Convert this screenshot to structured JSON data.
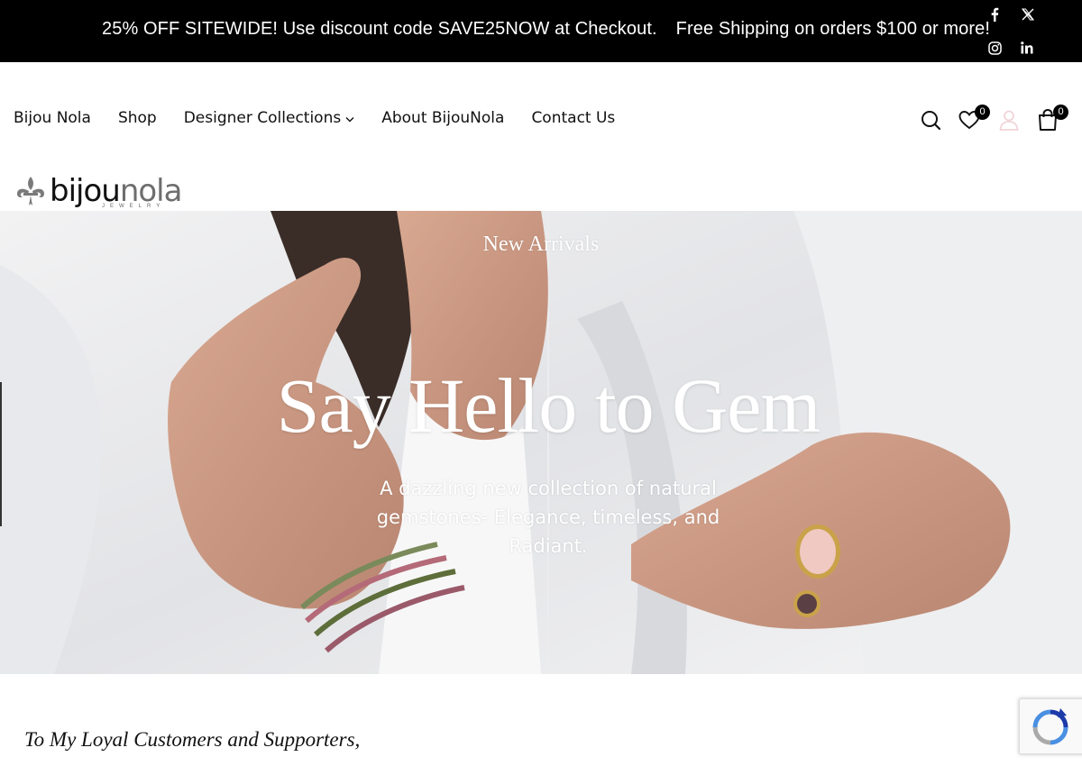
{
  "announcement": {
    "promo": "25% OFF SITEWIDE! Use discount code SAVE25NOW at Checkout.",
    "shipping": "Free Shipping on orders $100 or more!"
  },
  "social": [
    "facebook-icon",
    "x-icon",
    "instagram-icon",
    "linkedin-icon"
  ],
  "nav": {
    "items": [
      {
        "label": "Bijou Nola"
      },
      {
        "label": "Shop"
      },
      {
        "label": "Designer Collections",
        "has_dropdown": true
      },
      {
        "label": "About BijouNola"
      },
      {
        "label": "Contact Us"
      }
    ]
  },
  "header_icons": {
    "search": "search-icon",
    "wishlist": "heart-icon",
    "wishlist_count": "0",
    "account": "user-icon",
    "cart": "shopping-bag-icon",
    "cart_count": "0"
  },
  "logo": {
    "part1": "bijou",
    "part2": "nola",
    "tagline": "JEWELRY"
  },
  "hero": {
    "eyebrow": "New Arrivals",
    "headline": "Say Hello to Gem",
    "subtitle": "A dazzling new collection of natural gemstones- Elegance, timeless, and Radiant."
  },
  "letter": {
    "heading": "To My Loyal Customers and Supporters,"
  },
  "colors": {
    "topbar": "#000000",
    "text": "#111111",
    "logo_gray": "#6e6e6e",
    "hero_text": "#ffffff"
  }
}
